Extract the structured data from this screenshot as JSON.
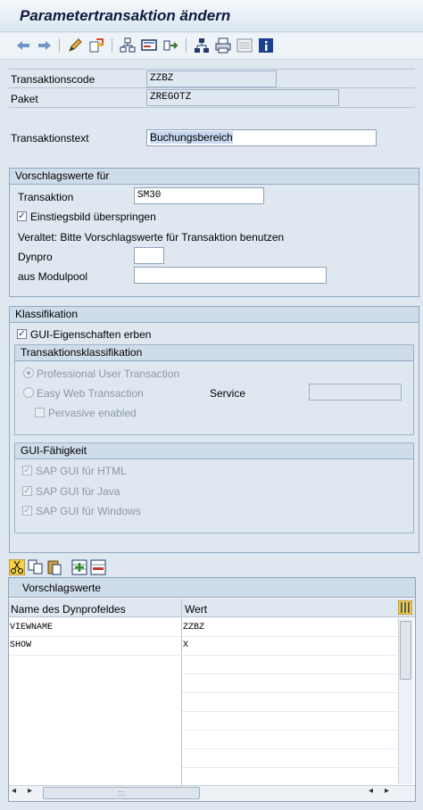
{
  "window": {
    "title": "Parametertransaktion ändern"
  },
  "toolbar": {
    "icons": [
      "back-arrow-icon",
      "forward-arrow-icon",
      "edit-pencil-icon",
      "display-change-icon",
      "hierarchy-icon",
      "screen-icon",
      "navigate-icon",
      "org-tree-icon",
      "print-icon",
      "list-icon",
      "info-icon"
    ]
  },
  "header": {
    "tcode_label": "Transaktionscode",
    "tcode_value": "ZZBZ",
    "package_label": "Paket",
    "package_value": "ZREGOTZ",
    "text_label": "Transaktionstext",
    "text_value": "Buchungsbereich"
  },
  "defaults": {
    "title": "Vorschlagswerte für",
    "transaction_label": "Transaktion",
    "transaction_value": "SM30",
    "skip_initial_label": "Einstiegsbild überspringen",
    "skip_initial_checked": true,
    "obsolete_note": "Veraltet: Bitte Vorschlagswerte für Transaktion benutzen",
    "dynpro_label": "Dynpro",
    "dynpro_value": "",
    "module_pool_label": "aus Modulpool",
    "module_pool_value": ""
  },
  "classification": {
    "title": "Klassifikation",
    "inherit_gui_label": "GUI-Eigenschaften erben",
    "inherit_gui_checked": true,
    "tx_class_title": "Transaktionsklassifikation",
    "professional_label": "Professional User Transaction",
    "easy_web_label": "Easy Web Transaction",
    "service_label": "Service",
    "pervasive_label": "Pervasive enabled",
    "gui_ability_title": "GUI-Fähigkeit",
    "gui_html_label": "SAP GUI für HTML",
    "gui_java_label": "SAP GUI für Java",
    "gui_windows_label": "SAP GUI für Windows"
  },
  "grid": {
    "title": "Vorschlagswerte",
    "columns": [
      "Name des Dynprofeldes",
      "Wert"
    ],
    "rows": [
      [
        "VIEWNAME",
        "ZZBZ"
      ],
      [
        "SHOW",
        "X"
      ]
    ],
    "toolbar_icons": [
      "cut-icon",
      "copy-icon",
      "paste-icon",
      "insert-row-icon",
      "delete-row-icon"
    ],
    "scroll_grip": ":::"
  },
  "colors": {
    "title": "#0c1c3e",
    "group_header": "#cfdcea",
    "background": "#dfe8f1"
  }
}
